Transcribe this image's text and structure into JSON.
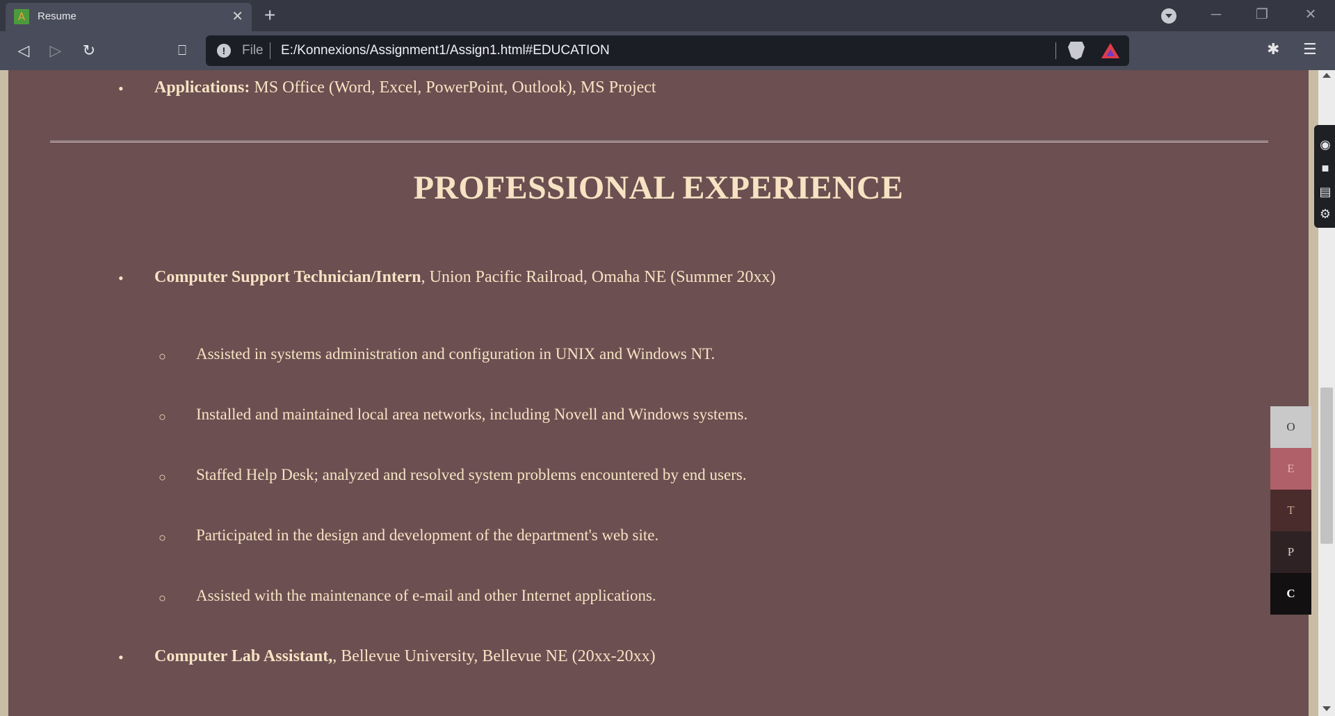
{
  "browser": {
    "tab_title": "Resume",
    "tab_favicon_letter": "A",
    "url_scheme_label": "File",
    "url": "E:/Konnexions/Assignment1/Assign1.html#EDUCATION"
  },
  "page": {
    "skills_row": {
      "label": "Applications:",
      "text": " MS Office (Word, Excel, PowerPoint, Outlook), MS Project"
    },
    "section_heading": "PROFESSIONAL EXPERIENCE",
    "jobs": [
      {
        "title": "Computer Support Technician/Intern",
        "details": ", Union Pacific Railroad, Omaha NE (Summer 20xx)",
        "duties": [
          "Assisted in systems administration and configuration in UNIX and Windows NT.",
          "Installed and maintained local area networks, including Novell and Windows systems.",
          "Staffed Help Desk; analyzed and resolved system problems encountered by end users.",
          "Participated in the design and development of the department's web site.",
          "Assisted with the maintenance of e-mail and other Internet applications."
        ]
      },
      {
        "title": "Computer Lab Assistant,",
        "details": ", Bellevue University, Bellevue NE (20xx-20xx)"
      }
    ],
    "side_nav": [
      "O",
      "E",
      "T",
      "P",
      "C"
    ]
  }
}
